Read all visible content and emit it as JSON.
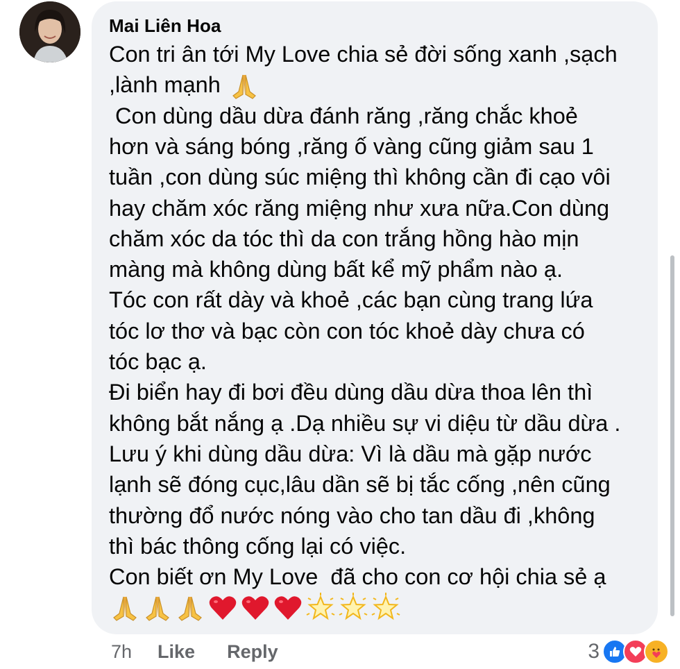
{
  "comment": {
    "author": "Mai Liên Hoa",
    "lines": [
      "Con tri ân tới My Love chia sẻ đời sống xanh ,sạch",
      ",lành mạnh",
      " Con dùng dầu dừa đánh răng ,răng chắc khoẻ",
      "hơn và sáng bóng ,răng ố vàng cũng giảm sau 1",
      "tuần ,con dùng súc miệng thì không cần đi cạo vôi",
      "hay chăm xóc răng miệng như xưa nữa.Con dùng",
      "chăm xóc da tóc thì da con trắng hồng hào mịn",
      "màng mà không dùng bất kể mỹ phẩm nào ạ.",
      "Tóc con rất dày và khoẻ ,các bạn cùng trang lứa",
      "tóc lơ thơ và bạc còn con tóc khoẻ dày chưa có",
      "tóc bạc ạ.",
      "Đi biển hay đi bơi đều dùng dầu dừa thoa lên thì",
      "không bắt nắng ạ .Dạ nhiều sự vi diệu từ dầu dừa .",
      "Lưu ý khi dùng dầu dừa: Vì là dầu mà gặp nước",
      "lạnh sẽ đóng cục,lâu dần sẽ bị tắc cống ,nên cũng",
      "thường đổ nước nóng vào cho tan dầu đi ,không",
      "thì bác thông cống lại có việc.",
      "Con biết ơn My Love  đã cho con cơ hội chia sẻ ạ"
    ],
    "inline_emoji": "folded-hands",
    "emoji_row": [
      "folded-hands",
      "folded-hands",
      "folded-hands",
      "red-heart",
      "red-heart",
      "red-heart",
      "glowing-star",
      "glowing-star",
      "glowing-star"
    ]
  },
  "footer": {
    "time": "7h",
    "like_label": "Like",
    "reply_label": "Reply",
    "reaction_count": "3",
    "reaction_types": [
      "like",
      "love",
      "care"
    ]
  },
  "colors": {
    "bubble": "#f0f2f5",
    "text": "#050505",
    "secondary": "#65676b",
    "like_blue": "#1877f2",
    "love_red": "#f33e58",
    "care_yellow": "#f7b125"
  }
}
